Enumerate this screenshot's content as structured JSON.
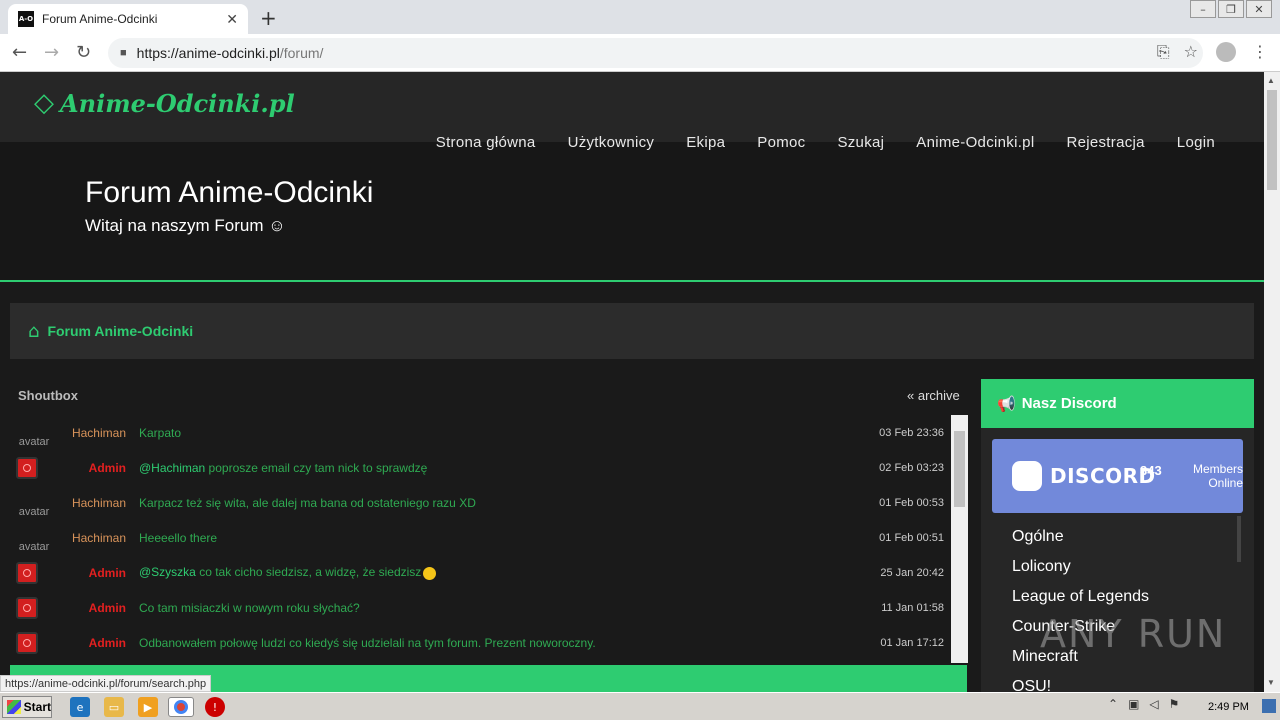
{
  "browser": {
    "tab_title": "Forum Anime-Odcinki",
    "favicon_text": "A-O",
    "url_host": "https://anime-odcinki.pl",
    "url_path": "/forum/",
    "status_url": "https://anime-odcinki.pl/forum/search.php"
  },
  "site": {
    "logo": "Anime-Odcinki.pl",
    "nav": [
      "Strona główna",
      "Użytkownicy",
      "Ekipa",
      "Pomoc",
      "Szukaj",
      "Anime-Odcinki.pl",
      "Rejestracja",
      "Login"
    ],
    "hero_title": "Forum Anime-Odcinki",
    "hero_subtitle": "Witaj na naszym Forum ☺",
    "breadcrumb": "Forum Anime-Odcinki",
    "accent_color": "#2ecc71"
  },
  "shoutbox": {
    "title": "Shoutbox",
    "archive": "« archive",
    "rows": [
      {
        "avatar": "image",
        "avatar_alt": "avatar",
        "user": "Hachiman",
        "mention": "",
        "text": "Karpato",
        "emoji": false,
        "time": "03 Feb 23:36"
      },
      {
        "avatar": "red",
        "avatar_alt": "",
        "user": "Admin",
        "mention": "@Hachiman",
        "text": " poprosze email czy tam nick to sprawdzę",
        "emoji": false,
        "time": "02 Feb 03:23"
      },
      {
        "avatar": "image",
        "avatar_alt": "avatar",
        "user": "Hachiman",
        "mention": "",
        "text": "Karpacz też się wita, ale dalej ma bana od ostateniego razu XD",
        "emoji": false,
        "time": "01 Feb 00:53"
      },
      {
        "avatar": "image",
        "avatar_alt": "avatar",
        "user": "Hachiman",
        "mention": "",
        "text": "Heeeello there",
        "emoji": false,
        "time": "01 Feb 00:51"
      },
      {
        "avatar": "red",
        "avatar_alt": "",
        "user": "Admin",
        "mention": "@Szyszka",
        "text": " co tak cicho siedzisz, a widzę, że siedzisz",
        "emoji": true,
        "time": "25 Jan 20:42"
      },
      {
        "avatar": "red",
        "avatar_alt": "",
        "user": "Admin",
        "mention": "",
        "text": "Co tam misiaczki w nowym roku słychać?",
        "emoji": false,
        "time": "11 Jan 01:58"
      },
      {
        "avatar": "red",
        "avatar_alt": "",
        "user": "Admin",
        "mention": "",
        "text": "Odbanowałem połowę ludzi co kiedyś się udzielali na tym forum. Prezent noworoczny.",
        "emoji": false,
        "time": "01 Jan 17:12"
      }
    ]
  },
  "discord": {
    "header": "Nasz Discord",
    "brand": "DISCORD",
    "count": "343",
    "members_label": "Members Online",
    "channels": [
      "Ogólne",
      "Lolicony",
      "League of Legends",
      "Counter-Strike",
      "Minecraft",
      "OSU!"
    ]
  },
  "watermark": "ANY RUN",
  "taskbar": {
    "start": "Start",
    "clock": "2:49 PM"
  }
}
